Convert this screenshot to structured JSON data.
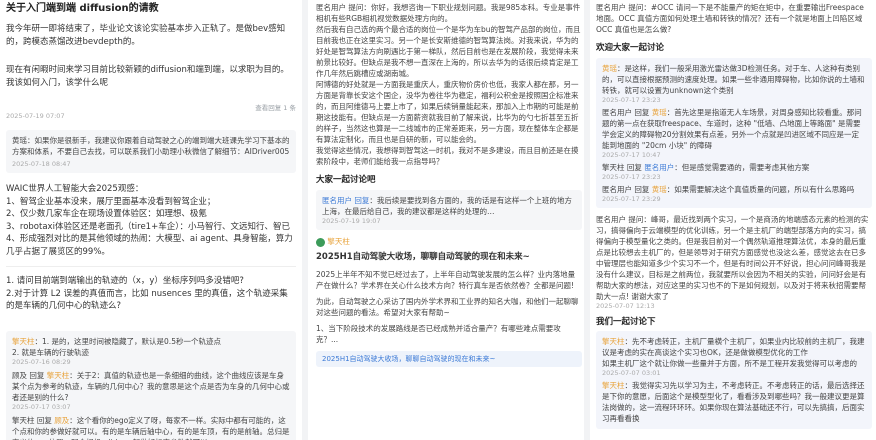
{
  "col1": {
    "post_title": "关于入门端到端 diffusion的请教",
    "post_body": "我今年研一即将结束了，毕业论文该论实验基本步入正轨了。是做bev感知的，跨模态蒸馏改进bevdepth的。",
    "post_body2": "现在有闲暇时间来学习目前比较新颖的diffusion和端到端，以求职为目的。我该如何入门，该学什么呢",
    "reply_label": "查看回复 1 条",
    "timestamp": "2025-07-19 07:07",
    "answer": "黄瑶：如果你是很新手，我建议你跟着自动驾驶之心的端到端大班课先学习下基本的方案和体系，不要自己去找，可以联系我们小助理小秋微信了解细节：AIDriver005",
    "answer_date": "2025-07-18 08:47",
    "waic_lines": [
      "WAIC世界人工智能大会2025观感：",
      "1、智驾企业基本没来，展厅里面基本没看到智驾企业；",
      "2、仅少数几家车企在现场设置体验区：如理想、极氪",
      "3、robotaxi体验区还是老面孔（tire1+车企）：小马智行、文远知行、智已",
      "4、形成强烈对比的是其他领域的热闹：大模型、ai agent、具身智能，算力几乎占据了展览区的99%。"
    ],
    "q1": "1. 请问目前端到端输出的轨迹的（x，y）坐标序列吗多没错吧?",
    "q2": "2.对于计算 L2 误差的真值而言，比如 nusences 里的真值，这个轨迹采集的是车辆的几何中心的轨迹么?",
    "c1_name": "擎天柱",
    "c1_text": "：1. 是的，这里时间被隐藏了，默认是0.5秒一个轨迹点",
    "c1_text2": "2. 就是车辆的行驶轨迹",
    "c1_date": "2025-07-16 08:29",
    "c2_prefix": "顾及 回复 ",
    "c2_name": "擎天柱",
    "c2_text": "：关于2：真值的轨迹也是一条细细的曲线，这个曲线应该是车身某个点为参考的轨迹，车辆的几何中心？我的意思是这个点是否为车身的几何中心或者还是别的什么?",
    "c2_date": "2025-07-17 03:07",
    "c3_prefix": "擎天柱 回复 ",
    "c3_name": "顾及",
    "c3_text": "：这个看你的ego定义了呀，每家不一样。实际中都有可能的，这个点和你的参做好就可以。有的是车辆后轴中心，有的是车顶，有的是前轴。总归是定义的ego位置，配合相机、lidar一起做好标定参数就可以",
    "c3_date": "2025-07-18 08:43"
  },
  "col2": {
    "intro": "匿名用户 提问：你好，我想咨询一下职业规划问题。我是985本科。专业是事件相机有些RGB相机视觉数据处理方向的。",
    "p1": "然后我有自己选的两个最合适的岗位一个是华为车bu的智驾产品部的岗位，而且目前我也正在这里实习。另一个是长安斯维德的智驾算法岗。对我来说，华为的好处是智驾算法方向刷遇比于第一梯队，然后目前也是在发展阶段，我觉得未来前景比较好。但缺点是我不想一直深在上海的，所以去华为的话很后续肯定是工作几年然后跳槽应或湖南城。",
    "p2": "阿博德的好处就是一方面我是重庆人，重庆物价房价也低，我家人都在那，另一方面是背靠长安这个国企，没华为卷往华为稳定，福利公积金是按照国企标准来的，而且阿维德马上要上市了，如果后续销量能起来，那加入上市期的可能是前期这技能有。但缺点是一方面薪资就我目前了解来说，比华为的勺七折甚至五折的样子，当然这也算是一二线城市的正常差距来，另一方面，现在整体车企都是有算法定制化，而且也是自研的新，可以能会的。",
    "p3": "我觉得这些情况，我想得到智驾这一时机，我对不是多建设，而且目前还是在摸索阶段中，老师们能给我一点指导吗？",
    "hist_title": "大家一起讨论吧",
    "h1_name": "匿名用户 回复",
    "h1_text": "：我后续是要找到各方面的，我的话是有这样一个上班的地方上海，在最后给自己，我的建议都是这样的处理的…",
    "h1_date": "2025-07-19 19:07",
    "article_avatar_label": "擎天柱",
    "article_title": "2025H1自动驾驶大收场，聊聊自动驾驶的现在和未来~",
    "article_p1": "2025上半年不知不觉已经过去了，上半年自动驾驶发展的怎么样？业内落地量产在做什么？学术界在关心什么技术方向？特行真车是否依然卷？全都是问题!",
    "article_p2": "为此，自动驾驶之心采访了国内外学术界和工业界的知名大咖，和他们一起聊聊对这些问题的看法。希望对大家有帮助~",
    "article_q1": "1、当下阶段技术的发展路线是否已经成熟并适合量产？有哪些难点需要攻克？...",
    "article_link": "2025H1自动驾驶大收场，聊聊自动驾驶的现在和未来~"
  },
  "col3": {
    "top_q": "匿名用户 提问：#OCC 请问一下是不能量产的矩在矩中，在重要输出Freespace 地面。OCC 真值方面如何处理土墙和转铁的情况？还有一个就是地面上凹陷区域 OCC 真值也是怎么做?",
    "welcome": "欢迎大家一起讨论",
    "a1_name": "黄瑶",
    "a1_text": "：是这样，我们一般采用激光雷达做3D检测任务。对于车、人这种有类别的，可以直接根据预测的速度处理。如果一些非通用障碍物，比如你说的土墙和转铁，就可以设置为unknown这个类别",
    "a1_date": "2025-07-17 23:23",
    "a2_name": "匿名用户 回复 ",
    "a2_nick": "黄瑶",
    "a2_text": "：首先这里是指道无人车场景，对周身感知比较看重。那问题的第一点在获取freespace、车道时，这种 \"低墙、凸地面上等路面\" 是需要学会定义的障碍物20分割效果有点差，另外一个点就是凹进区域不同应是一定能到地面的 \"20cm 小块\" 的障碍",
    "a2_date": "2025-07-17 10:47",
    "a3_name": "擎天柱 回复 ",
    "a3_nick": "匿名用户",
    "a3_text": "：但是感觉需要通的，需要考虑其他方案",
    "a3_date": "2025-07-17 23:23",
    "a4_name": "匿名用户 回复 ",
    "a4_nick": "黄瑶",
    "a4_text": "：如果需要解决这个真值质量的问题，所以有什么思路吗",
    "a4_date": "2025-07-17 23:29",
    "b1": "匿名用户 提问：峰哥，最近找到两个实习，一个是商汤的地端感态元素的检测的实习，搞得偏向于云端模型的优化训练，另一个是主机厂的端型部落方向的实习，搞得偏向于模型量化之类的。但是我目前对一个偶然轨道推理算法优，本身的最后重点是比较想去主机厂的，但是领导对于研究方面感觉也没这么差，感觉这去在已多中管理层也能知道多少个实习不一个，但是有时间公开不好说，担心问问峰哥我是没有什么建议，目标是之前两位，我就要所以会因为不相关的实验，问问好会是有帮助大家的想法，对应这里的实习也不的下是如何规划，以及对于将来秋招需要帮助大一点! 谢谢大家了",
    "b1_date": "2025-07-07 12:13",
    "discuss2": "我们一起讨论下",
    "b2_name": "擎天柱",
    "b2_text": "：先不考虑转正，主机厂量横个主机厂，如果业内比较前的主机厂，我建议是考虑的实在高谈这个实习也OK，还是做做模型优化的工作",
    "b2_text2": "如果主机厂这个就让你做一些量并于方面，所不是工程开发我觉得可以考虑的",
    "b2_date": "2025-07-07 03:01",
    "b3_name": "擎天柱",
    "b3_text": "：我觉得实习先以学习为主，不考虑转正。不考虑转正的话，最后选择还是下你的意愿，后面这个是模型型化了，看看涉及到哪些吗？我一般建议更是算法岗做的，这一流程环环环。如果你现在算法基础还不行，可以先搞搞，后面实习再看看换"
  }
}
